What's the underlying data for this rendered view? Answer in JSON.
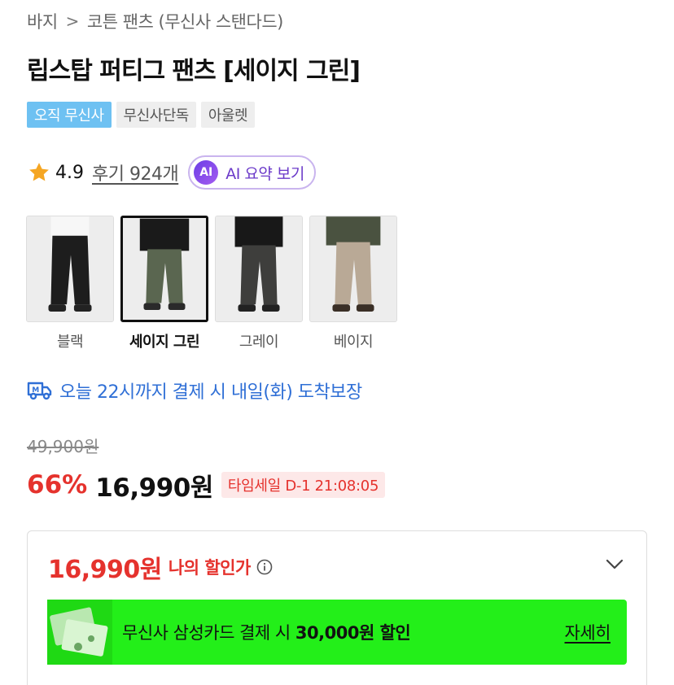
{
  "breadcrumb": {
    "category": "바지",
    "separator": ">",
    "subcategory": "코튼 팬츠 (무신사 스탠다드)"
  },
  "product": {
    "title": "립스탑 퍼티그 팬츠 [세이지 그린]"
  },
  "tags": [
    "오직 무신사",
    "무신사단독",
    "아울렛"
  ],
  "rating": {
    "score": "4.9",
    "reviews_label": "후기 924개",
    "ai_badge": "AI",
    "ai_label": "AI 요약 보기"
  },
  "colors": [
    {
      "name": "블랙",
      "selected": false,
      "pants": "#1d1d1d",
      "top": "#f2f2f2"
    },
    {
      "name": "세이지 그린",
      "selected": true,
      "pants": "#5a6650",
      "top": "#1a1a1a"
    },
    {
      "name": "그레이",
      "selected": false,
      "pants": "#3e3e3c",
      "top": "#181818"
    },
    {
      "name": "베이지",
      "selected": false,
      "pants": "#b9a996",
      "top": "#4a5240"
    }
  ],
  "delivery": {
    "text": "오늘 22시까지 결제 시 내일(화) 도착보장",
    "icon": "truck-icon"
  },
  "pricing": {
    "original": "49,900원",
    "discount": "66%",
    "price": "16,990원",
    "timesale": "타임세일 D-1 21:08:05"
  },
  "my_price": {
    "price": "16,990원",
    "label": "나의 할인가"
  },
  "card_promo": {
    "text_prefix": "무신사 삼성카드 결제 시 ",
    "text_amount": "30,000원 할인",
    "link": "자세히",
    "background": "#23ef19"
  },
  "colors_theme": {
    "accent_red": "#e5322d",
    "accent_blue": "#2f6fd6",
    "tag_blue": "#6ec1f2",
    "ai_purple": "#6b3ac9"
  }
}
